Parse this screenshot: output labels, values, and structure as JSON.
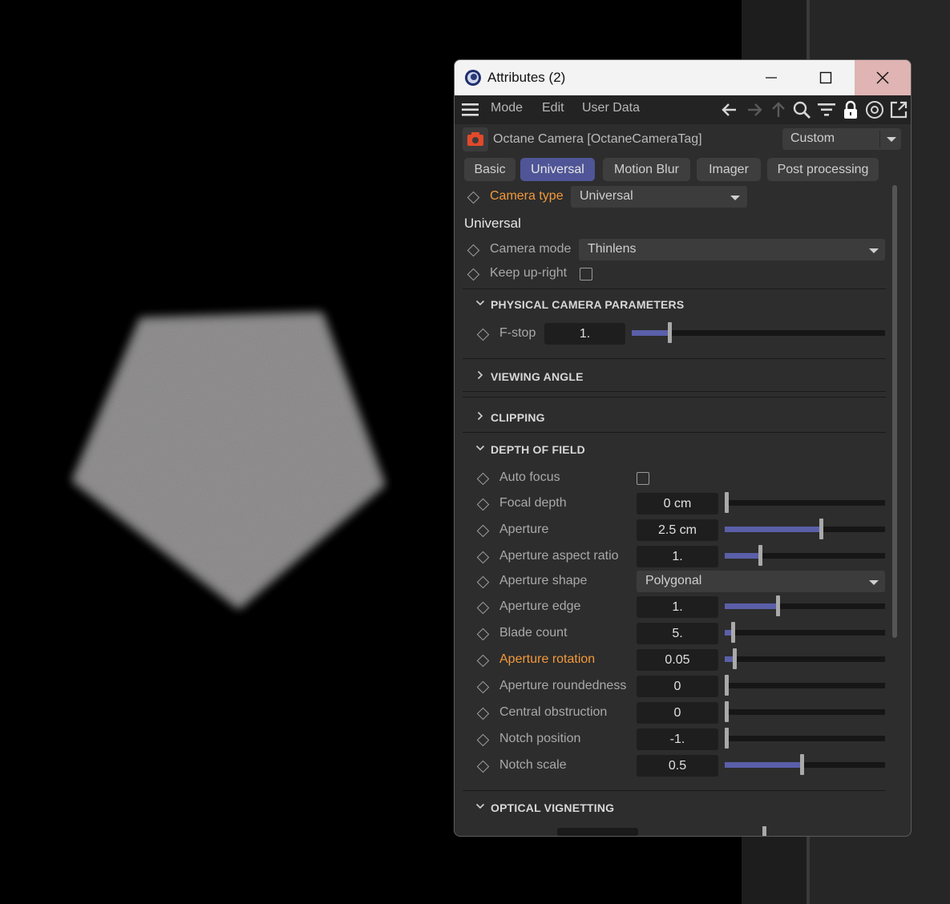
{
  "window": {
    "title": "Attributes (2)"
  },
  "menu": {
    "items": [
      "Mode",
      "Edit",
      "User Data"
    ]
  },
  "object": {
    "title": "Octane Camera [OctaneCameraTag]",
    "preset": "Custom"
  },
  "tabs": [
    {
      "label": "Basic",
      "active": false
    },
    {
      "label": "Universal",
      "active": true
    },
    {
      "label": "Motion Blur",
      "active": false
    },
    {
      "label": "Imager",
      "active": false
    },
    {
      "label": "Post processing",
      "active": false
    }
  ],
  "camera_type": {
    "label": "Camera type",
    "value": "Universal"
  },
  "universal": {
    "heading": "Universal",
    "camera_mode": {
      "label": "Camera mode",
      "value": "Thinlens"
    },
    "keep_upright": {
      "label": "Keep up-right",
      "checked": false
    }
  },
  "sections": {
    "physical": "PHYSICAL CAMERA PARAMETERS",
    "viewing": "VIEWING ANGLE",
    "clipping": "CLIPPING",
    "dof": "DEPTH OF FIELD",
    "vignetting": "OPTICAL VIGNETTING"
  },
  "fstop": {
    "label": "F-stop",
    "value": "1.",
    "fraction": 0.15
  },
  "dof": {
    "auto_focus": {
      "label": "Auto focus",
      "checked": false
    },
    "focal_depth": {
      "label": "Focal depth",
      "value": "0 cm",
      "fraction": 0.0
    },
    "aperture": {
      "label": "Aperture",
      "value": "2.5 cm",
      "fraction": 0.6
    },
    "aperture_aspect_ratio": {
      "label": "Aperture aspect ratio",
      "value": "1.",
      "fraction": 0.22
    },
    "aperture_shape": {
      "label": "Aperture shape",
      "value": "Polygonal"
    },
    "aperture_edge": {
      "label": "Aperture edge",
      "value": "1.",
      "fraction": 0.33
    },
    "blade_count": {
      "label": "Blade count",
      "value": "5.",
      "fraction": 0.05
    },
    "aperture_rotation": {
      "label": "Aperture rotation",
      "value": "0.05",
      "fraction": 0.06
    },
    "aperture_roundedness": {
      "label": "Aperture roundedness",
      "value": "0",
      "fraction": 0.0
    },
    "central_obstruction": {
      "label": "Central obstruction",
      "value": "0",
      "fraction": 0.0
    },
    "notch_position": {
      "label": "Notch position",
      "value": "-1.",
      "fraction": 0.0
    },
    "notch_scale": {
      "label": "Notch scale",
      "value": "0.5",
      "fraction": 0.48
    }
  },
  "colors": {
    "accent": "#4f5596",
    "slider_fill": "#5a5fa8",
    "highlight_label": "#f2993b",
    "panel": "#2d2d2d",
    "close_hover": "#dfb4b2"
  },
  "icons": [
    "hamburger-icon",
    "arrow-left-icon",
    "arrow-right-icon",
    "arrow-up-icon",
    "search-icon",
    "filter-icon",
    "lock-icon",
    "target-icon",
    "new-window-icon",
    "camera-icon",
    "keyframe-diamond-icon",
    "chevron-down-icon",
    "chevron-right-icon"
  ]
}
